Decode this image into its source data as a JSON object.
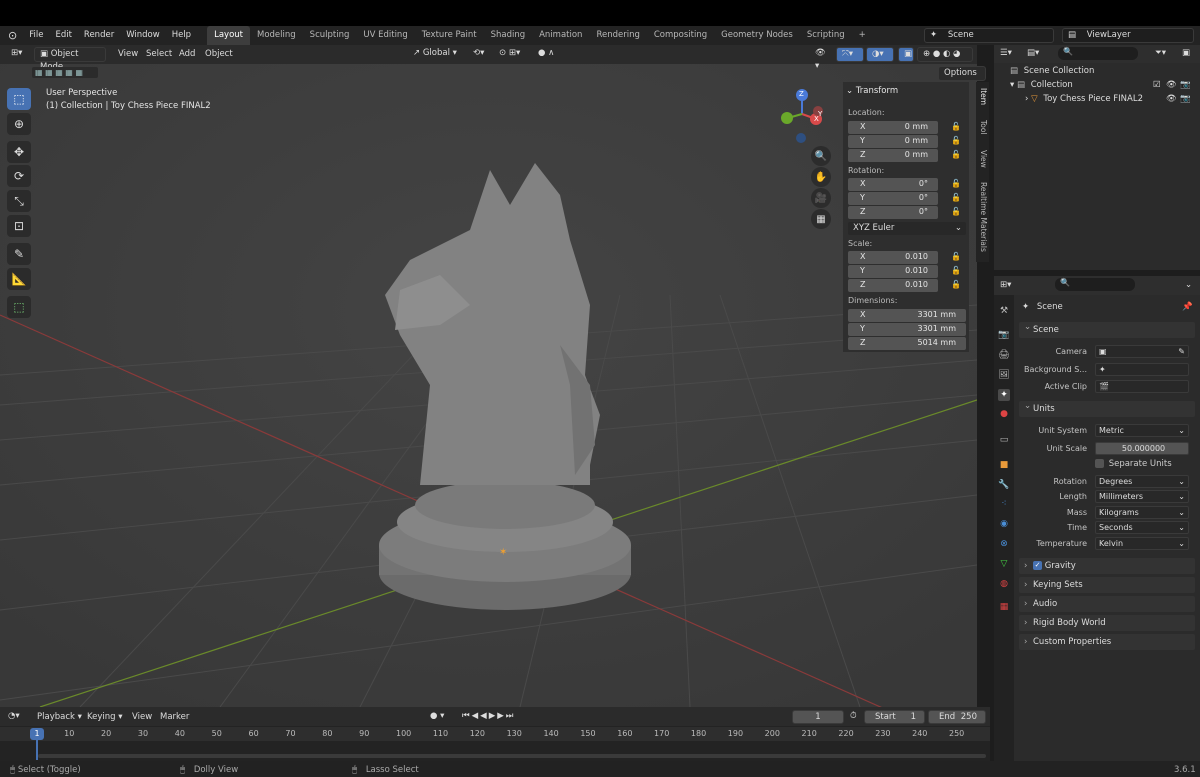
{
  "menu": [
    "File",
    "Edit",
    "Render",
    "Window",
    "Help"
  ],
  "workspaces": [
    "Layout",
    "Modeling",
    "Sculpting",
    "UV Editing",
    "Texture Paint",
    "Shading",
    "Animation",
    "Rendering",
    "Compositing",
    "Geometry Nodes",
    "Scripting"
  ],
  "active_workspace": "Layout",
  "scene_field": "Scene",
  "viewlayer_field": "ViewLayer",
  "header": {
    "mode": "Object Mode",
    "view": "View",
    "select": "Select",
    "add": "Add",
    "object": "Object",
    "orientation": "Global",
    "options": "Options"
  },
  "viewport": {
    "perspective": "User Perspective",
    "collection_info": "(1) Collection | Toy Chess Piece FINAL2"
  },
  "npanel": {
    "title": "Transform",
    "location_label": "Location:",
    "location": [
      {
        "axis": "X",
        "value": "0 mm"
      },
      {
        "axis": "Y",
        "value": "0 mm"
      },
      {
        "axis": "Z",
        "value": "0 mm"
      }
    ],
    "rotation_label": "Rotation:",
    "rotation": [
      {
        "axis": "X",
        "value": "0°"
      },
      {
        "axis": "Y",
        "value": "0°"
      },
      {
        "axis": "Z",
        "value": "0°"
      }
    ],
    "rotation_mode": "XYZ Euler",
    "scale_label": "Scale:",
    "scale": [
      {
        "axis": "X",
        "value": "0.010"
      },
      {
        "axis": "Y",
        "value": "0.010"
      },
      {
        "axis": "Z",
        "value": "0.010"
      }
    ],
    "dimensions_label": "Dimensions:",
    "dimensions": [
      {
        "axis": "X",
        "value": "3301 mm"
      },
      {
        "axis": "Y",
        "value": "3301 mm"
      },
      {
        "axis": "Z",
        "value": "5014 mm"
      }
    ],
    "tabs": [
      "Item",
      "Tool",
      "View",
      "Realtime Materials"
    ]
  },
  "gizmo": {
    "z": "Z",
    "y": "Y",
    "x": "X"
  },
  "outliner": {
    "scene_collection": "Scene Collection",
    "collection": "Collection",
    "object": "Toy Chess Piece FINAL2"
  },
  "props": {
    "context": "Scene",
    "scene_section": "Scene",
    "camera_label": "Camera",
    "bg_label": "Background S...",
    "clip_label": "Active Clip",
    "units_section": "Units",
    "unit_system_label": "Unit System",
    "unit_system": "Metric",
    "unit_scale_label": "Unit Scale",
    "unit_scale": "50.000000",
    "separate_units": "Separate Units",
    "rotation_label": "Rotation",
    "rotation": "Degrees",
    "length_label": "Length",
    "length": "Millimeters",
    "mass_label": "Mass",
    "mass": "Kilograms",
    "time_label": "Time",
    "time": "Seconds",
    "temperature_label": "Temperature",
    "temperature": "Kelvin",
    "sections": [
      "Gravity",
      "Keying Sets",
      "Audio",
      "Rigid Body World",
      "Custom Properties"
    ]
  },
  "timeline": {
    "playback": "Playback",
    "keying": "Keying",
    "view": "View",
    "marker": "Marker",
    "current_frame": "1",
    "start_label": "Start",
    "start": "1",
    "end_label": "End",
    "end": "250",
    "ticks": [
      "1",
      "10",
      "20",
      "30",
      "40",
      "50",
      "60",
      "70",
      "80",
      "90",
      "100",
      "110",
      "120",
      "130",
      "140",
      "150",
      "160",
      "170",
      "180",
      "190",
      "200",
      "210",
      "220",
      "230",
      "240",
      "250"
    ]
  },
  "status": {
    "select": "Select (Toggle)",
    "dolly": "Dolly View",
    "lasso": "Lasso Select",
    "version": "3.6.1"
  }
}
